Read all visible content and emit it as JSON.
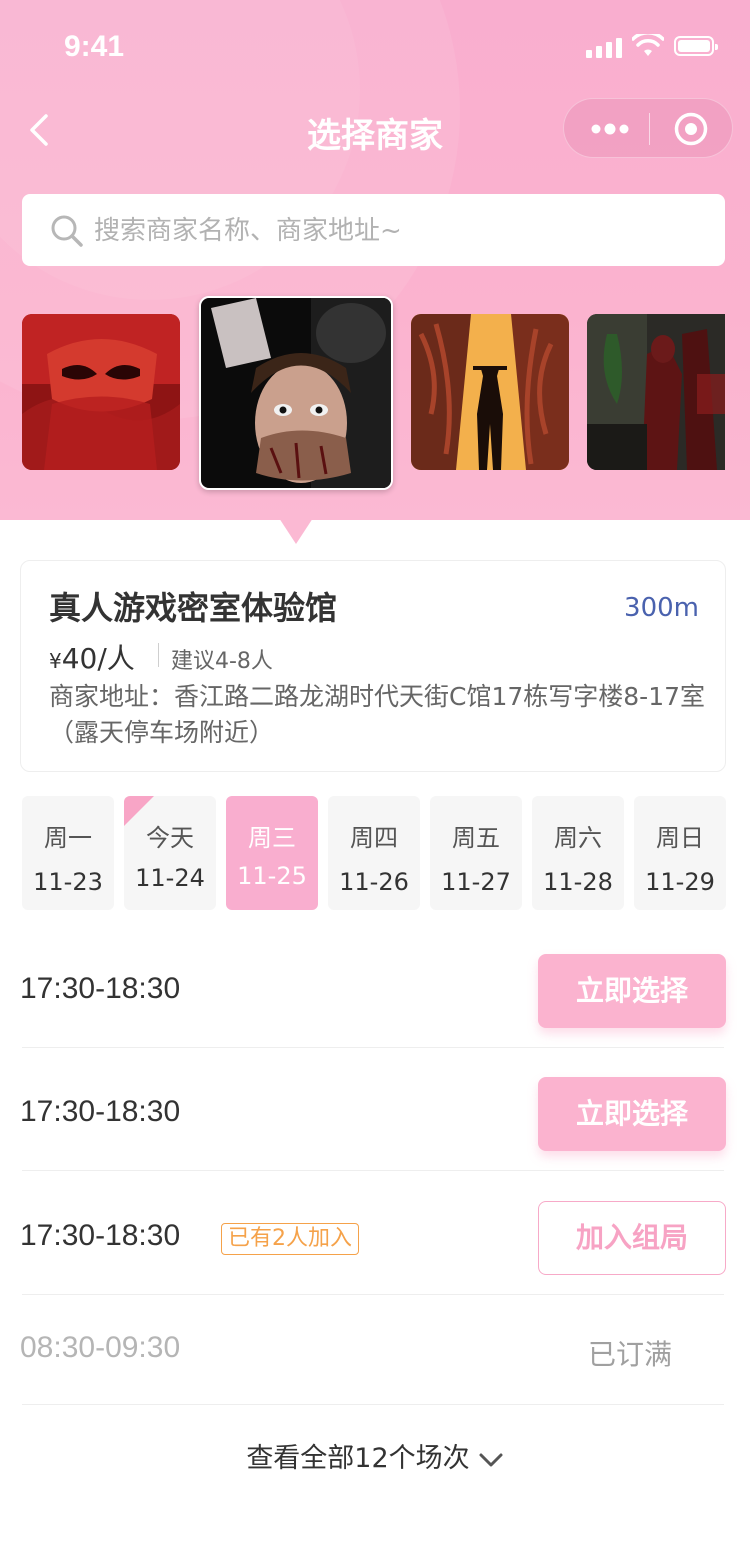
{
  "status_bar": {
    "time": "9:41"
  },
  "nav": {
    "title": "选择商家"
  },
  "search": {
    "placeholder": "搜索商家名称、商家地址~"
  },
  "merchant": {
    "name": "真人游戏密室体验馆",
    "distance": "300m",
    "currency": "¥",
    "price": "40",
    "per": "/人",
    "suggest": "建议4-8人",
    "address": "商家地址：香江路二路龙湖时代天街C馆17栋写字楼8-17室（露天停车场附近）"
  },
  "dates": [
    {
      "weekday": "周一",
      "date": "11-23"
    },
    {
      "weekday": "今天",
      "date": "11-24"
    },
    {
      "weekday": "周三",
      "date": "11-25"
    },
    {
      "weekday": "周四",
      "date": "11-26"
    },
    {
      "weekday": "周五",
      "date": "11-27"
    },
    {
      "weekday": "周六",
      "date": "11-28"
    },
    {
      "weekday": "周日",
      "date": "11-29"
    }
  ],
  "slots": [
    {
      "time": "17:30-18:30",
      "action": "立即选择"
    },
    {
      "time": "17:30-18:30",
      "action": "立即选择"
    },
    {
      "time": "17:30-18:30",
      "badge": "已有2人加入",
      "action": "加入组局"
    },
    {
      "time": "08:30-09:30",
      "action": "已订满"
    }
  ],
  "more": {
    "label": "查看全部12个场次"
  },
  "colors": {
    "accent": "#fbb3cf",
    "distance": "#4a62ae",
    "badge": "#f5a24a",
    "muted": "#a0a0a0"
  }
}
